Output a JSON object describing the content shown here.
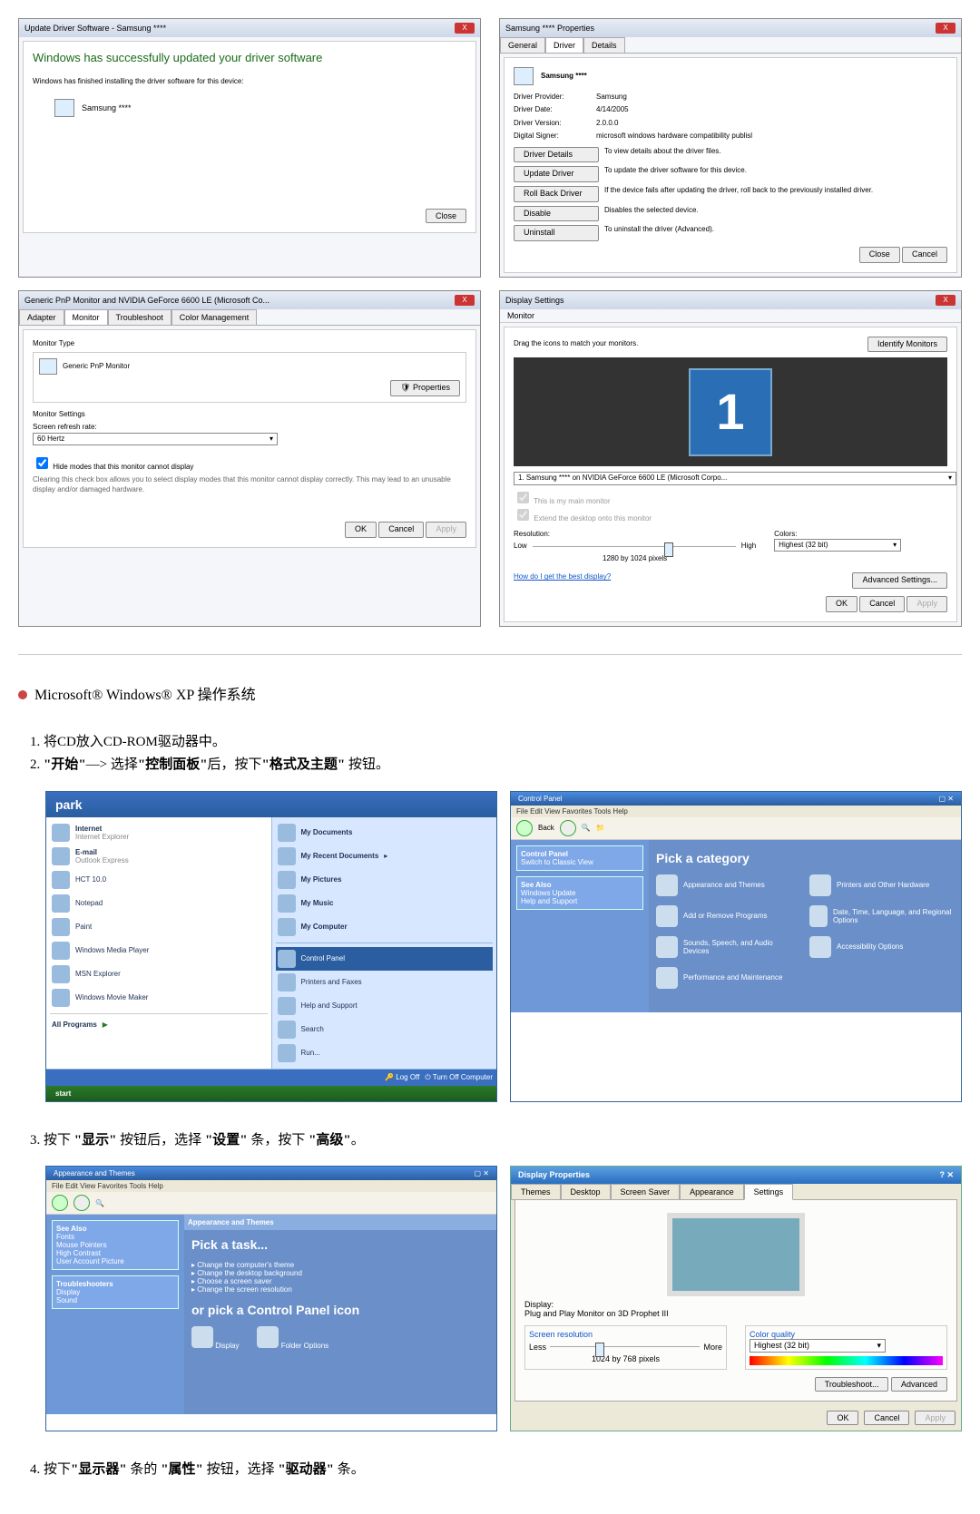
{
  "top": {
    "updater": {
      "title": "Update Driver Software - Samsung ****",
      "main_msg": "Windows has successfully updated your driver software",
      "sub_msg": "Windows has finished installing the driver software for this device:",
      "device": "Samsung ****",
      "close_btn": "Close"
    },
    "driverprops": {
      "title": "Samsung **** Properties",
      "tabs": {
        "general": "General",
        "driver": "Driver",
        "details": "Details"
      },
      "device": "Samsung ****",
      "provider_lab": "Driver Provider:",
      "provider": "Samsung",
      "date_lab": "Driver Date:",
      "date": "4/14/2005",
      "version_lab": "Driver Version:",
      "version": "2.0.0.0",
      "signer_lab": "Digital Signer:",
      "signer": "microsoft windows hardware compatibility publisl",
      "btn_details": "Driver Details",
      "txt_details": "To view details about the driver files.",
      "btn_update": "Update Driver",
      "txt_update": "To update the driver software for this device.",
      "btn_rollback": "Roll Back Driver",
      "txt_rollback": "If the device fails after updating the driver, roll back to the previously installed driver.",
      "btn_disable": "Disable",
      "txt_disable": "Disables the selected device.",
      "btn_uninstall": "Uninstall",
      "txt_uninstall": "To uninstall the driver (Advanced).",
      "close": "Close",
      "cancel": "Cancel"
    },
    "monprops": {
      "title": "Generic PnP Monitor and NVIDIA GeForce 6600 LE (Microsoft Co...",
      "tabs": {
        "adapter": "Adapter",
        "monitor": "Monitor",
        "troubleshoot": "Troubleshoot",
        "color": "Color Management"
      },
      "montype_lab": "Monitor Type",
      "montype": "Generic PnP Monitor",
      "props_btn": "Properties",
      "settings_lab": "Monitor Settings",
      "refresh_lab": "Screen refresh rate:",
      "refresh_val": "60 Hertz",
      "hide_chk": "Hide modes that this monitor cannot display",
      "hide_desc": "Clearing this check box allows you to select display modes that this monitor cannot display correctly. This may lead to an unusable display and/or damaged hardware.",
      "ok": "OK",
      "cancel": "Cancel",
      "apply": "Apply"
    },
    "dispset": {
      "title": "Display Settings",
      "subtitle": "Monitor",
      "drag": "Drag the icons to match your monitors.",
      "identify": "Identify Monitors",
      "num": "1",
      "sel": "1. Samsung **** on NVIDIA GeForce 6600 LE (Microsoft Corpo...",
      "mainmon": "This is my main monitor",
      "extend": "Extend the desktop onto this monitor",
      "res_lab": "Resolution:",
      "low": "Low",
      "high": "High",
      "res": "1280 by 1024 pixels",
      "colors_lab": "Colors:",
      "colors": "Highest (32 bit)",
      "link": "How do I get the best display?",
      "adv": "Advanced Settings...",
      "ok": "OK",
      "cancel": "Cancel",
      "apply": "Apply"
    }
  },
  "heading_xp": "Microsoft® Windows® XP 操作系统",
  "steps12": {
    "s1": "将CD放入CD-ROM驱动器中。",
    "s2_a": "\"开始\"",
    "s2_b": "—> 选择",
    "s2_c": "\"控制面板\"",
    "s2_d": "后，按下",
    "s2_e": "\"格式及主题\"",
    "s2_f": " 按钮。"
  },
  "xp_start": {
    "username": "park",
    "left": {
      "ie": "Internet",
      "ie2": "Internet Explorer",
      "em": "E-mail",
      "em2": "Outlook Express",
      "hct": "HCT 10.0",
      "np": "Notepad",
      "paint": "Paint",
      "wmp": "Windows Media Player",
      "msn": "MSN Explorer",
      "wmm": "Windows Movie Maker",
      "all": "All Programs"
    },
    "right": {
      "mydocs": "My Documents",
      "recent": "My Recent Documents",
      "pics": "My Pictures",
      "music": "My Music",
      "comp": "My Computer",
      "cp": "Control Panel",
      "printers": "Printers and Faxes",
      "help": "Help and Support",
      "search": "Search",
      "run": "Run..."
    },
    "logoff": "Log Off",
    "turnoff": "Turn Off Computer",
    "start": "start"
  },
  "xp_cp1": {
    "title": "Control Panel",
    "menu": "File   Edit   View   Favorites   Tools   Help",
    "back": "Back",
    "side_cp": "Control Panel",
    "side_sw": "Switch to Classic View",
    "side_see": "See Also",
    "side_wu": "Windows Update",
    "side_help": "Help and Support",
    "pick": "Pick a category",
    "cats": {
      "appear": "Appearance and Themes",
      "printers": "Printers and Other Hardware",
      "add": "Add or Remove Programs",
      "date": "Date, Time, Language, and Regional Options",
      "sound": "Sounds, Speech, and Audio Devices",
      "access": "Accessibility Options",
      "perf": "Performance and Maintenance"
    }
  },
  "step3_a": "按下 ",
  "step3_b": "\"显示\"",
  "step3_c": " 按钮后，选择 ",
  "step3_d": "\"设置\"",
  "step3_e": " 条，按下 ",
  "step3_f": "\"高级\"",
  "step3_g": "。",
  "xp_appearance": {
    "title": "Appearance and Themes",
    "menu": "File   Edit   View   Favorites   Tools   Help",
    "side": {
      "see": "See Also",
      "fonts": "Fonts",
      "mouse": "Mouse Pointers",
      "hc": "High Contrast",
      "ua": "User Account Picture",
      "tb": "Troubleshooters",
      "disp": "Display",
      "sound": "Sound"
    },
    "pick": "Pick a task...",
    "tasks": {
      "t1": "Change the computer's theme",
      "t2": "Change the desktop background",
      "t3": "Choose a screen saver",
      "t4": "Change the screen resolution"
    },
    "or": "or pick a Control Panel icon",
    "icons": {
      "display": "Display",
      "folder": "Folder Options"
    }
  },
  "xp_dispprops": {
    "title": "Display Properties",
    "tabs": {
      "themes": "Themes",
      "desktop": "Desktop",
      "screensaver": "Screen Saver",
      "appearance": "Appearance",
      "settings": "Settings"
    },
    "display_lab": "Display:",
    "display_val": "Plug and Play Monitor on 3D Prophet III",
    "screenres": "Screen resolution",
    "less": "Less",
    "more": "More",
    "res": "1024 by 768 pixels",
    "colorq": "Color quality",
    "color": "Highest (32 bit)",
    "trouble": "Troubleshoot...",
    "adv": "Advanced",
    "ok": "OK",
    "cancel": "Cancel",
    "apply": "Apply"
  },
  "step4_a": "按下",
  "step4_b": "\"显示器\"",
  "step4_c": " 条的 ",
  "step4_d": "\"属性\"",
  "step4_e": " 按钮，选择 ",
  "step4_f": "\"驱动器\"",
  "step4_g": " 条。"
}
